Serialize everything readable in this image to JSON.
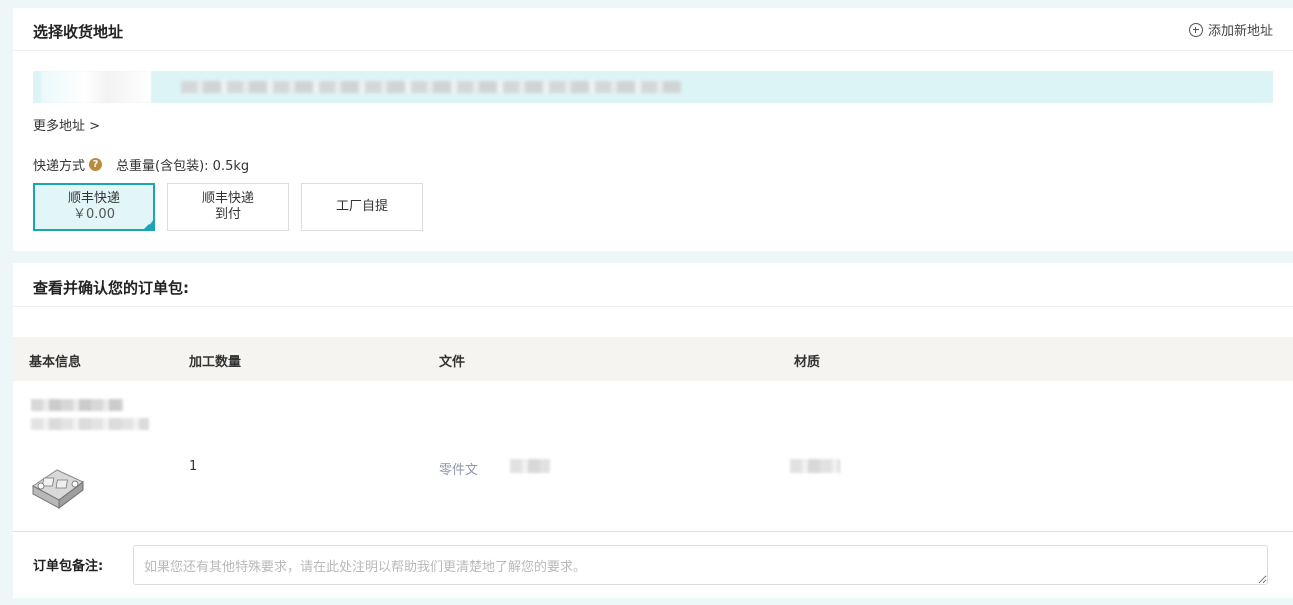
{
  "address_section": {
    "title": "选择收货地址",
    "add_new": "添加新地址",
    "more": "更多地址 >"
  },
  "shipping": {
    "label": "快递方式",
    "weight_label": "总重量(含包装): 0.5kg",
    "options": [
      {
        "line1": "顺丰快递",
        "line2": "￥0.00",
        "selected": true
      },
      {
        "line1": "顺丰快递",
        "line2": "到付",
        "selected": false
      },
      {
        "line1": "工厂自提",
        "line2": "",
        "selected": false
      }
    ]
  },
  "order_section": {
    "title": "查看并确认您的订单包:",
    "columns": [
      "基本信息",
      "加工数量",
      "文件",
      "材质"
    ],
    "row": {
      "quantity": "1",
      "file": "零件文"
    },
    "remark_label": "订单包备注:",
    "remark_placeholder": "如果您还有其他特殊要求，请在此处注明以帮助我们更清楚地了解您的要求。"
  },
  "colors": {
    "accent": "#1ba5b2",
    "selected_bg": "#e2f6f8",
    "help_icon": "#b78b3a",
    "table_head_bg": "#f5f4f0"
  },
  "icons": [
    "plus-circle-icon",
    "question-icon",
    "check-corner-icon",
    "part-thumbnail"
  ]
}
